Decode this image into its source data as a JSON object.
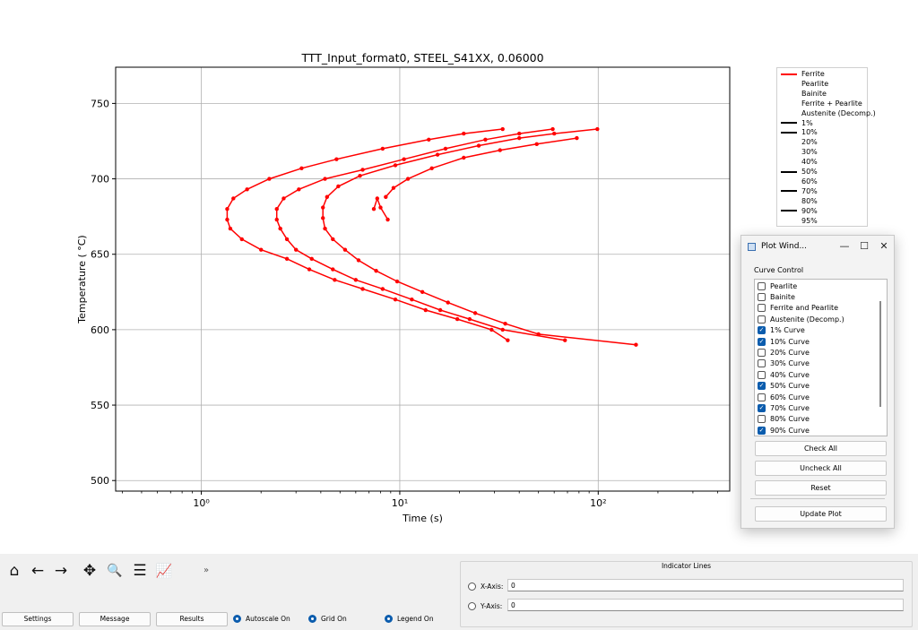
{
  "chart_data": {
    "type": "line",
    "title": "TTT_Input_format0, STEEL_S41XX, 0.06000",
    "xlabel": "Time (s)",
    "ylabel": "Temperature ( °C)",
    "xscale": "log",
    "xlim": [
      0.37,
      460
    ],
    "ylim": [
      493,
      774
    ],
    "x_ticks": [
      1,
      10,
      100
    ],
    "x_tick_labels": [
      "10⁰",
      "10¹",
      "10²"
    ],
    "y_ticks": [
      500,
      550,
      600,
      650,
      700,
      750
    ],
    "y_tick_labels": [
      "500",
      "550",
      "600",
      "650",
      "700",
      "750"
    ],
    "grid": true,
    "line_color": "#ff0000",
    "series": [
      {
        "name": "1%",
        "x": [
          7.4,
          7.7,
          8.0,
          8.7
        ],
        "y": [
          680,
          687,
          681,
          673
        ]
      },
      {
        "name": "10%",
        "x": [
          33,
          21,
          14,
          8.2,
          4.8,
          3.2,
          2.2,
          1.7,
          1.45,
          1.35,
          1.35,
          1.4,
          1.6,
          2.0,
          2.7,
          3.5,
          4.7,
          6.5,
          9.5,
          13.5,
          19.5,
          29,
          35
        ],
        "y": [
          733,
          730,
          726,
          720,
          713,
          707,
          700,
          693,
          687,
          680,
          673,
          667,
          660,
          653,
          647,
          640,
          633,
          627,
          620,
          613,
          607,
          600,
          593
        ]
      },
      {
        "name": "50%",
        "x": [
          59,
          40,
          27,
          17,
          10.5,
          6.5,
          4.2,
          3.1,
          2.6,
          2.4,
          2.4,
          2.5,
          2.7,
          3.0,
          3.6,
          4.6,
          6.0,
          8.2,
          11.5,
          16,
          22.5,
          33,
          68
        ],
        "y": [
          733,
          730,
          726,
          720,
          713,
          706,
          700,
          693,
          687,
          680,
          673,
          667,
          660,
          653,
          647,
          640,
          633,
          627,
          620,
          613,
          607,
          600,
          593
        ]
      },
      {
        "name": "70%",
        "x": [
          99,
          60,
          40,
          25,
          15.5,
          9.5,
          6.3,
          4.9,
          4.3,
          4.1,
          4.1,
          4.2,
          4.6,
          5.3,
          6.2,
          7.6,
          9.7,
          13,
          17.5,
          24,
          34,
          50,
          155
        ],
        "y": [
          733,
          730,
          727,
          722,
          716,
          709,
          702,
          695,
          688,
          681,
          674,
          667,
          660,
          653,
          646,
          639,
          632,
          625,
          618,
          611,
          604,
          597,
          590
        ]
      },
      {
        "name": "90%",
        "x": [
          78,
          49,
          32,
          21,
          14.5,
          11,
          9.3,
          8.5
        ],
        "y": [
          727,
          723,
          719,
          714,
          707,
          700,
          694,
          688
        ]
      }
    ],
    "legend_entries": [
      {
        "label": "Ferrite",
        "swatch": "#ff0000"
      },
      {
        "label": "Pearlite",
        "swatch": ""
      },
      {
        "label": "Bainite",
        "swatch": ""
      },
      {
        "label": "Ferrite + Pearlite",
        "swatch": ""
      },
      {
        "label": "Austenite (Decomp.)",
        "swatch": ""
      },
      {
        "label": "1%",
        "swatch": "#000000"
      },
      {
        "label": "10%",
        "swatch": "#000000"
      },
      {
        "label": "20%",
        "swatch": ""
      },
      {
        "label": "30%",
        "swatch": ""
      },
      {
        "label": "40%",
        "swatch": ""
      },
      {
        "label": "50%",
        "swatch": "#000000"
      },
      {
        "label": "60%",
        "swatch": ""
      },
      {
        "label": "70%",
        "swatch": "#000000"
      },
      {
        "label": "80%",
        "swatch": ""
      },
      {
        "label": "90%",
        "swatch": "#000000"
      },
      {
        "label": "95%",
        "swatch": ""
      }
    ],
    "legend_position": "outside-right"
  },
  "plot_window": {
    "title": "Plot Wind...",
    "curve_control_label": "Curve Control",
    "items": [
      {
        "label": "Pearlite",
        "checked": false
      },
      {
        "label": "Bainite",
        "checked": false
      },
      {
        "label": "Ferrite and Pearlite",
        "checked": false
      },
      {
        "label": "Austenite (Decomp.)",
        "checked": false
      },
      {
        "label": "1% Curve",
        "checked": true
      },
      {
        "label": "10% Curve",
        "checked": true
      },
      {
        "label": "20% Curve",
        "checked": false
      },
      {
        "label": "30% Curve",
        "checked": false
      },
      {
        "label": "40% Curve",
        "checked": false
      },
      {
        "label": "50% Curve",
        "checked": true
      },
      {
        "label": "60% Curve",
        "checked": false
      },
      {
        "label": "70% Curve",
        "checked": true
      },
      {
        "label": "80% Curve",
        "checked": false
      },
      {
        "label": "90% Curve",
        "checked": true
      }
    ],
    "check_all": "Check All",
    "uncheck_all": "Uncheck All",
    "reset": "Reset",
    "update_plot": "Update Plot",
    "minimize_glyph": "—",
    "maximize_glyph": "☐",
    "close_glyph": "✕"
  },
  "toolbar": {
    "icons": [
      "home-icon",
      "back-arrow-icon",
      "forward-arrow-icon",
      "pan-icon",
      "zoom-icon",
      "configure-subplots-icon",
      "edit-axis-icon"
    ],
    "glyphs": [
      "⌂",
      "←",
      "→",
      "✥",
      "🔍",
      "☰",
      "📈"
    ],
    "overflow": "»"
  },
  "bottom": {
    "settings": "Settings",
    "message": "Message",
    "results": "Results",
    "autoscale": "Autoscale On",
    "grid": "Grid On",
    "legend": "Legend On"
  },
  "indicator": {
    "title": "Indicator Lines",
    "x_label": "X-Axis:",
    "y_label": "Y-Axis:",
    "x_value": "0",
    "y_value": "0"
  }
}
